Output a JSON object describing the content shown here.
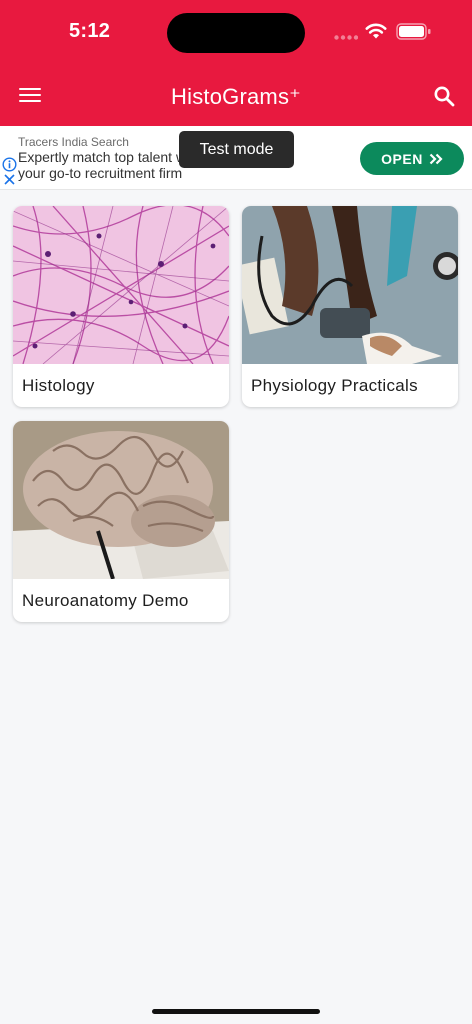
{
  "status": {
    "time": "5:12"
  },
  "header": {
    "title": "HistoGrams⁺"
  },
  "ad": {
    "source": "Tracers India Search",
    "line1": "Expertly match top talent with companies -",
    "line2": "your go-to recruitment firm",
    "cta": "OPEN",
    "toast": "Test mode"
  },
  "cards": [
    {
      "label": "Histology"
    },
    {
      "label": "Physiology Practicals"
    },
    {
      "label": "Neuroanatomy Demo"
    }
  ],
  "colors": {
    "brand": "#e8193f",
    "cta": "#0c8a5c"
  }
}
